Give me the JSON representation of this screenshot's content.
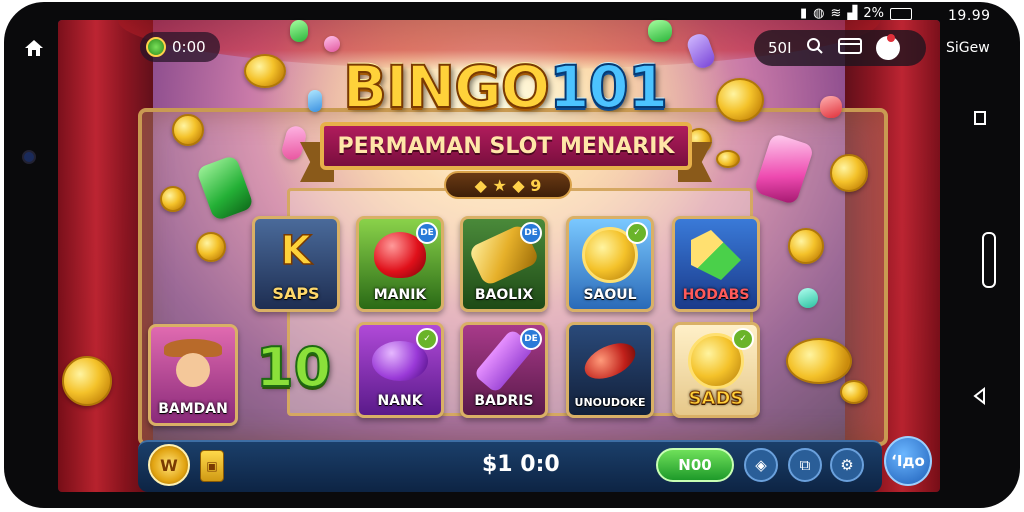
{
  "status": {
    "time": "19.99",
    "battery": "2%",
    "side_label": "SiGew"
  },
  "top_left": {
    "value": "0:00"
  },
  "top_right": {
    "value": "50I"
  },
  "title": {
    "part1": "BINGO",
    "part2": "101",
    "subtitle": "PERMAMAN SLOT MENARIK",
    "stars_value": "9"
  },
  "tiles": [
    {
      "label": "SAPS",
      "badge": ""
    },
    {
      "label": "MANIK",
      "badge": "DE"
    },
    {
      "label": "BAOLIX",
      "badge": "DE"
    },
    {
      "label": "SAOUL",
      "badge": ""
    },
    {
      "label": "HODABS",
      "badge": ""
    },
    {
      "label": "BAMDAN",
      "badge": ""
    },
    {
      "label": "NANK",
      "badge": ""
    },
    {
      "label": "BADRIS",
      "badge": "DE"
    },
    {
      "label": "UNOUDOKE",
      "badge": ""
    },
    {
      "label": "SADS",
      "badge": ""
    }
  ],
  "big_number": "10",
  "bottom": {
    "balance": "$1 0:0",
    "go_label": "N00",
    "spin_label": "ʻIдo",
    "coin_label": "W"
  }
}
